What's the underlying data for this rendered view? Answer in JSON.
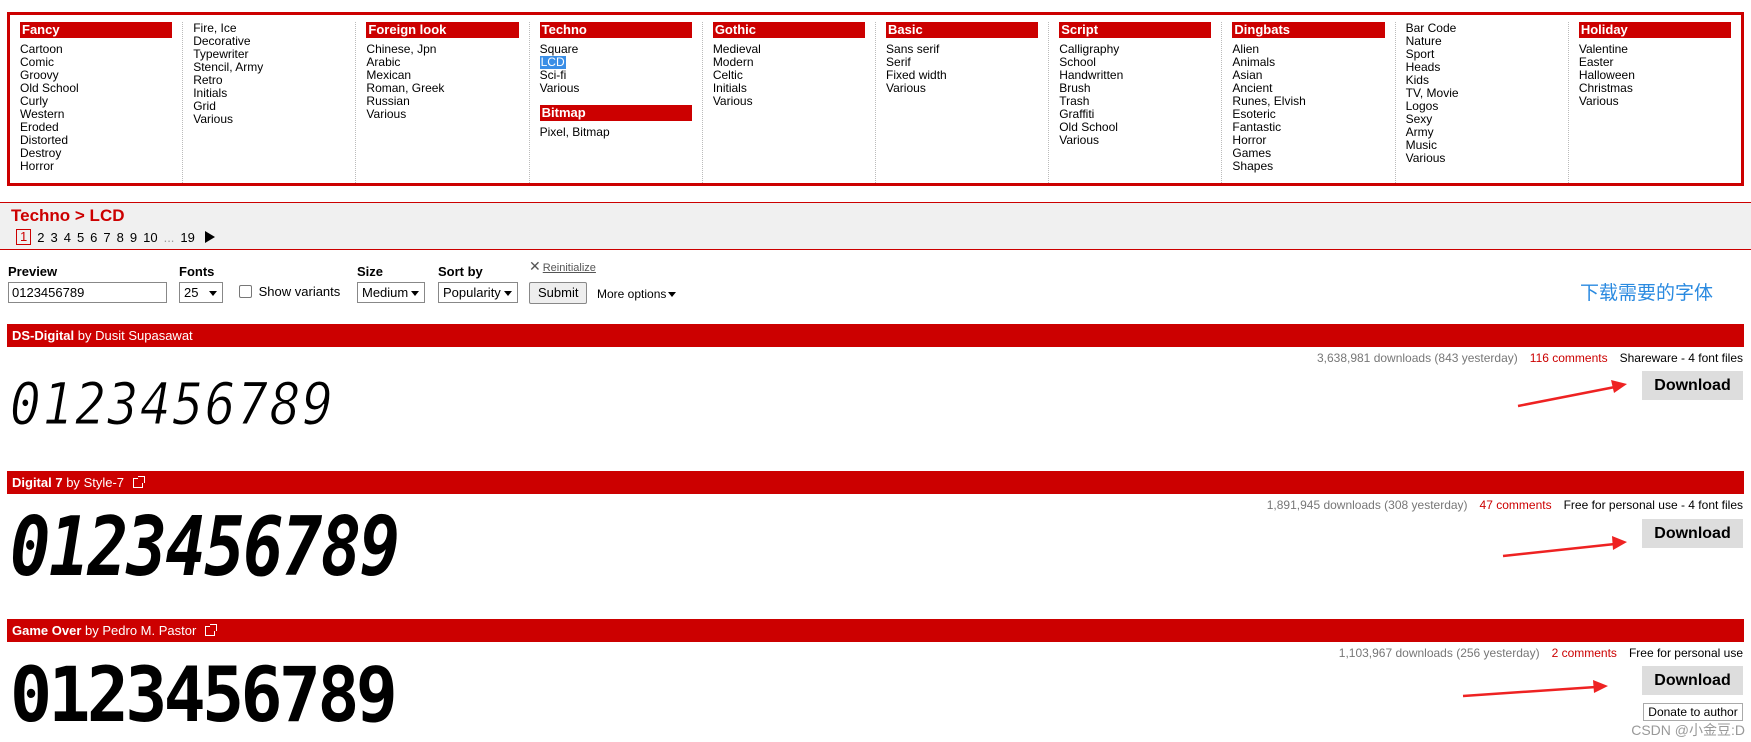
{
  "menu": [
    {
      "head": "Fancy",
      "items": [
        "Cartoon",
        "Comic",
        "Groovy",
        "Old School",
        "Curly",
        "Western",
        "Eroded",
        "Distorted",
        "Destroy",
        "Horror"
      ]
    },
    {
      "head": "",
      "items": [
        "Fire, Ice",
        "Decorative",
        "Typewriter",
        "Stencil, Army",
        "Retro",
        "Initials",
        "Grid",
        "Various"
      ]
    },
    {
      "head": "Foreign look",
      "items": [
        "Chinese, Jpn",
        "Arabic",
        "Mexican",
        "Roman, Greek",
        "Russian",
        "Various"
      ]
    },
    {
      "head": "Techno",
      "items": [
        "Square",
        "LCD",
        "Sci-fi",
        "Various"
      ],
      "head2": "Bitmap",
      "items2": [
        "Pixel, Bitmap"
      ]
    },
    {
      "head": "Gothic",
      "items": [
        "Medieval",
        "Modern",
        "Celtic",
        "Initials",
        "Various"
      ]
    },
    {
      "head": "Basic",
      "items": [
        "Sans serif",
        "Serif",
        "Fixed width",
        "Various"
      ]
    },
    {
      "head": "Script",
      "items": [
        "Calligraphy",
        "School",
        "Handwritten",
        "Brush",
        "Trash",
        "Graffiti",
        "Old School",
        "Various"
      ]
    },
    {
      "head": "Dingbats",
      "items": [
        "Alien",
        "Animals",
        "Asian",
        "Ancient",
        "Runes, Elvish",
        "Esoteric",
        "Fantastic",
        "Horror",
        "Games",
        "Shapes"
      ]
    },
    {
      "head": "",
      "items": [
        "Bar Code",
        "Nature",
        "Sport",
        "Heads",
        "Kids",
        "TV, Movie",
        "Logos",
        "Sexy",
        "Army",
        "Music",
        "Various"
      ]
    },
    {
      "head": "Holiday",
      "items": [
        "Valentine",
        "Easter",
        "Halloween",
        "Christmas",
        "Various"
      ]
    }
  ],
  "breadcrumb": "Techno > LCD",
  "pager": {
    "current": "1",
    "pages": [
      "2",
      "3",
      "4",
      "5",
      "6",
      "7",
      "8",
      "9",
      "10"
    ],
    "dots": "...",
    "last": "19"
  },
  "options": {
    "preview_label": "Preview",
    "preview_value": "0123456789",
    "fonts_label": "Fonts",
    "fonts_value": "25",
    "show_variants": "Show variants",
    "size_label": "Size",
    "size_value": "Medium",
    "sort_label": "Sort by",
    "sort_value": "Popularity",
    "submit": "Submit",
    "more_options": "More options",
    "reinitialize": "Reinitialize"
  },
  "note": "下载需要的字体",
  "fonts": [
    {
      "name": "DS-Digital",
      "by": "by",
      "author": "Dusit Supasawat",
      "external": false,
      "downloads": "3,638,981 downloads (843 yesterday)",
      "comments": "116 comments",
      "license": "Shareware - 4 font files",
      "download": "Download",
      "sample": "0123456789"
    },
    {
      "name": "Digital 7",
      "by": "by",
      "author": "Style-7",
      "external": true,
      "downloads": "1,891,945 downloads (308 yesterday)",
      "comments": "47 comments",
      "license": "Free for personal use - 4 font files",
      "download": "Download",
      "sample": "0123456789"
    },
    {
      "name": "Game Over",
      "by": "by",
      "author": "Pedro M. Pastor",
      "external": true,
      "downloads": "1,103,967 downloads (256 yesterday)",
      "comments": "2 comments",
      "license": "Free for personal use",
      "download": "Download",
      "donate": "Donate to author",
      "sample": "0123456789"
    }
  ],
  "watermark": "CSDN @小金豆:D",
  "colors": {
    "brand_red": "#cc0000",
    "link_blue": "#2a8ae0",
    "arrow_red": "#ee2222"
  }
}
